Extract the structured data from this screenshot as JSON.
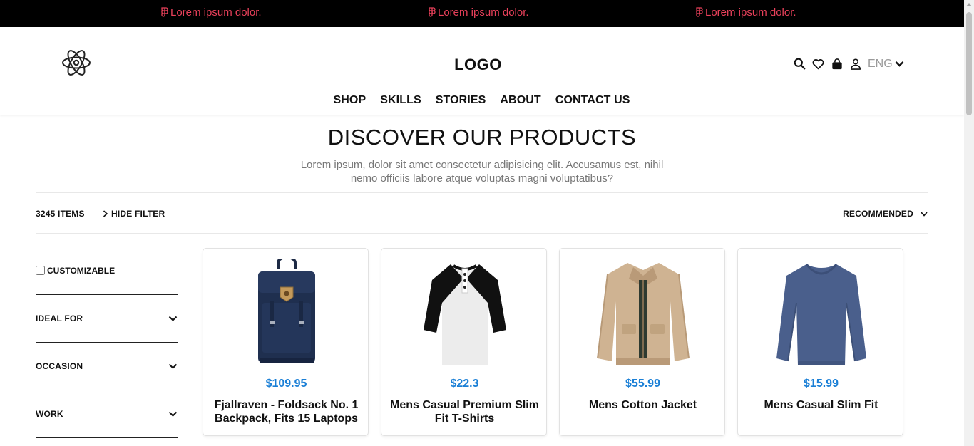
{
  "promo": {
    "items": [
      "Lorem ipsum dolor.",
      "Lorem ipsum dolor.",
      "Lorem ipsum dolor."
    ],
    "icon": "figma-icon",
    "color": "#e8405a"
  },
  "header": {
    "brand_icon": "atom-icon",
    "logo": "LOGO",
    "tools": [
      "search-icon",
      "heart-icon",
      "shopping-bag-icon",
      "user-icon"
    ],
    "language": "ENG"
  },
  "nav": {
    "items": [
      "SHOP",
      "SKILLS",
      "STORIES",
      "ABOUT",
      "CONTACT US"
    ]
  },
  "hero": {
    "title": "DISCOVER OUR PRODUCTS",
    "subtitle": "Lorem ipsum, dolor sit amet consectetur adipisicing elit. Accusamus est, nihil nemo officiis labore atque voluptas magni voluptatibus?"
  },
  "toolbar": {
    "items_count": "3245 ITEMS",
    "hide_filter": "HIDE FILTER",
    "sort": "RECOMMENDED"
  },
  "filters": {
    "customizable_label": "CUSTOMIZABLE",
    "customizable_checked": false,
    "facets": [
      "IDEAL FOR",
      "OCCASION",
      "WORK"
    ]
  },
  "products": [
    {
      "price": "$109.95",
      "name": "Fjallraven - Foldsack No. 1 Backpack, Fits 15 Laptops",
      "image": "backpack"
    },
    {
      "price": "$22.3",
      "name": "Mens Casual Premium Slim Fit T-Shirts",
      "image": "raglan-tshirt"
    },
    {
      "price": "$55.99",
      "name": "Mens Cotton Jacket",
      "image": "cotton-jacket"
    },
    {
      "price": "$15.99",
      "name": "Mens Casual Slim Fit",
      "image": "long-sleeve-shirt"
    }
  ],
  "colors": {
    "price": "#1a7fd6",
    "promo_bg": "#000000",
    "text": "#111111"
  }
}
